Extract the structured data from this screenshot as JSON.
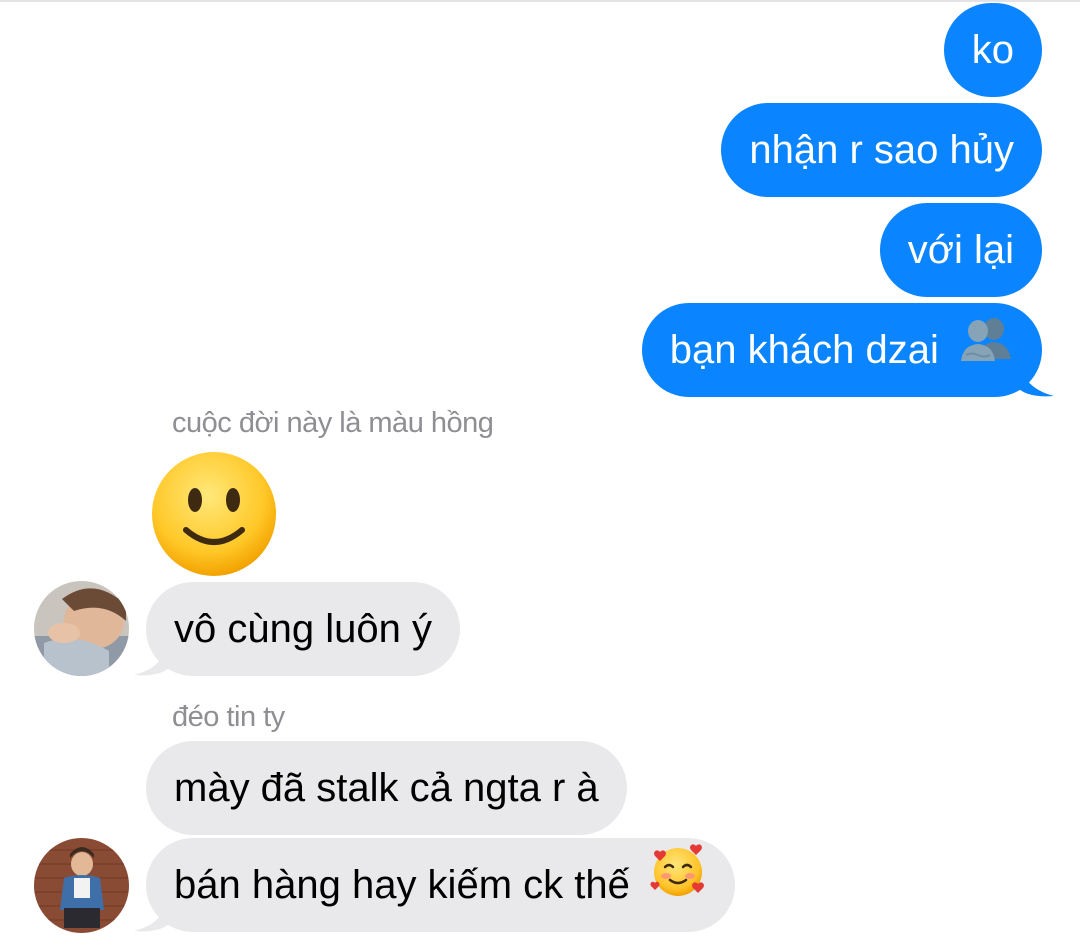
{
  "outgoing": [
    {
      "text": "ko"
    },
    {
      "text": "nhận r sao hủy"
    },
    {
      "text": "với lại"
    },
    {
      "text": "bạn khách dzai",
      "emoji": "busts-in-silhouette-icon"
    }
  ],
  "incoming_group_1": {
    "sender": "cuộc đời này là màu hồng",
    "big_emoji": "slightly-smiling-face-icon",
    "message": "vô cùng luôn ý"
  },
  "incoming_group_2": {
    "sender": "đéo tin ty",
    "messages": [
      {
        "text": "mày đã stalk cả ngta r à"
      },
      {
        "text": "bán hàng hay kiếm ck thế",
        "emoji": "smiling-face-with-hearts-icon"
      }
    ]
  },
  "colors": {
    "outgoing_bubble": "#0a84ff",
    "incoming_bubble": "#e9e9eb",
    "sender_label": "#8e8e93"
  }
}
